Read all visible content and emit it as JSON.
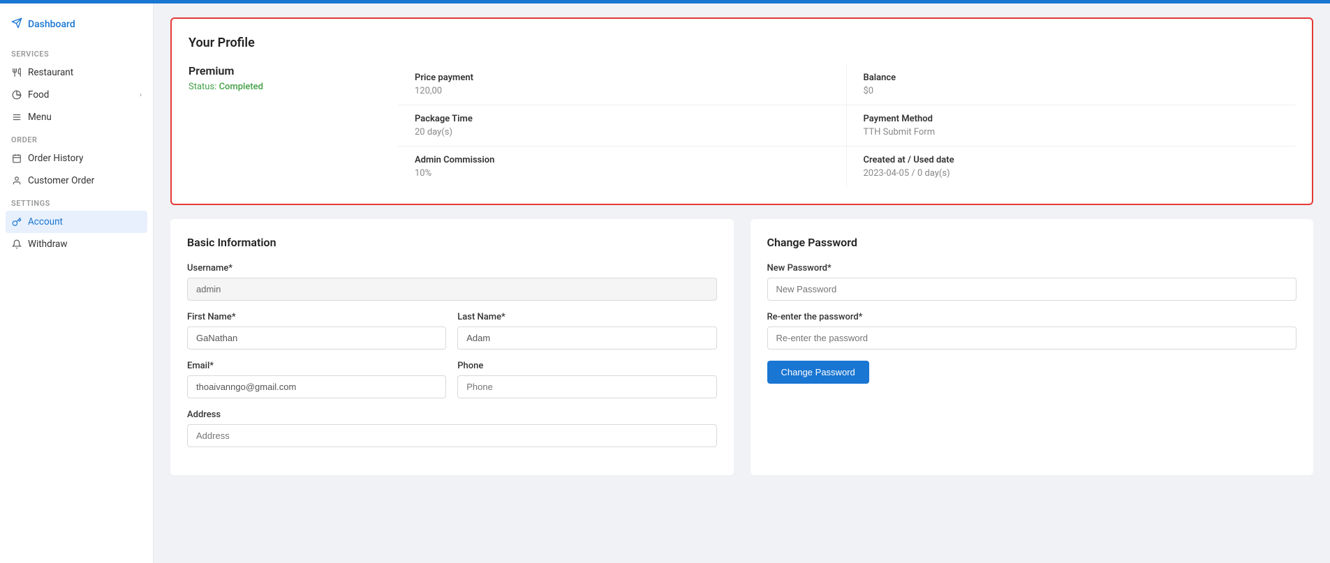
{
  "topBar": {
    "color": "#1976d2"
  },
  "sidebar": {
    "logo": {
      "label": "Dashboard",
      "icon": "send-icon"
    },
    "sections": [
      {
        "label": "SERVICES",
        "items": [
          {
            "id": "restaurant",
            "label": "Restaurant",
            "icon": "restaurant-icon",
            "active": false,
            "hasChevron": false
          },
          {
            "id": "food",
            "label": "Food",
            "icon": "food-icon",
            "active": false,
            "hasChevron": true
          },
          {
            "id": "menu",
            "label": "Menu",
            "icon": "menu-icon",
            "active": false,
            "hasChevron": false
          }
        ]
      },
      {
        "label": "ORDER",
        "items": [
          {
            "id": "order-history",
            "label": "Order History",
            "icon": "order-history-icon",
            "active": false,
            "hasChevron": false
          },
          {
            "id": "customer-order",
            "label": "Customer Order",
            "icon": "customer-order-icon",
            "active": false,
            "hasChevron": false
          }
        ]
      },
      {
        "label": "SETTINGS",
        "items": [
          {
            "id": "account",
            "label": "Account",
            "icon": "account-icon",
            "active": true,
            "hasChevron": false
          },
          {
            "id": "withdraw",
            "label": "Withdraw",
            "icon": "withdraw-icon",
            "active": false,
            "hasChevron": false
          }
        ]
      }
    ]
  },
  "profileCard": {
    "title": "Your Profile",
    "planName": "Premium",
    "statusLabel": "Status:",
    "statusValue": "Completed",
    "stats": [
      {
        "label": "Price payment",
        "value": "120,00"
      },
      {
        "label": "Balance",
        "value": "$0"
      },
      {
        "label": "Package Time",
        "value": "20 day(s)"
      },
      {
        "label": "Payment Method",
        "value": "TTH Submit Form"
      },
      {
        "label": "Admin Commission",
        "value": "10%"
      },
      {
        "label": "Created at / Used date",
        "value": "2023-04-05 / 0 day(s)"
      }
    ]
  },
  "basicInfo": {
    "title": "Basic Information",
    "fields": {
      "username": {
        "label": "Username*",
        "value": "admin",
        "placeholder": "admin"
      },
      "firstName": {
        "label": "First Name*",
        "value": "GaNathan",
        "placeholder": "GaNathan"
      },
      "lastName": {
        "label": "Last Name*",
        "value": "Adam",
        "placeholder": "Adam"
      },
      "email": {
        "label": "Email*",
        "value": "thoaivanngo@gmail.com",
        "placeholder": "thoaivanngo@gmail.com"
      },
      "phone": {
        "label": "Phone",
        "value": "",
        "placeholder": "Phone"
      },
      "address": {
        "label": "Address",
        "value": "",
        "placeholder": "Address"
      }
    }
  },
  "changePassword": {
    "title": "Change Password",
    "newPassword": {
      "label": "New Password*",
      "placeholder": "New Password"
    },
    "reEnter": {
      "label": "Re-enter the password*",
      "placeholder": "Re-enter the password"
    },
    "submitButton": "Change Password"
  }
}
